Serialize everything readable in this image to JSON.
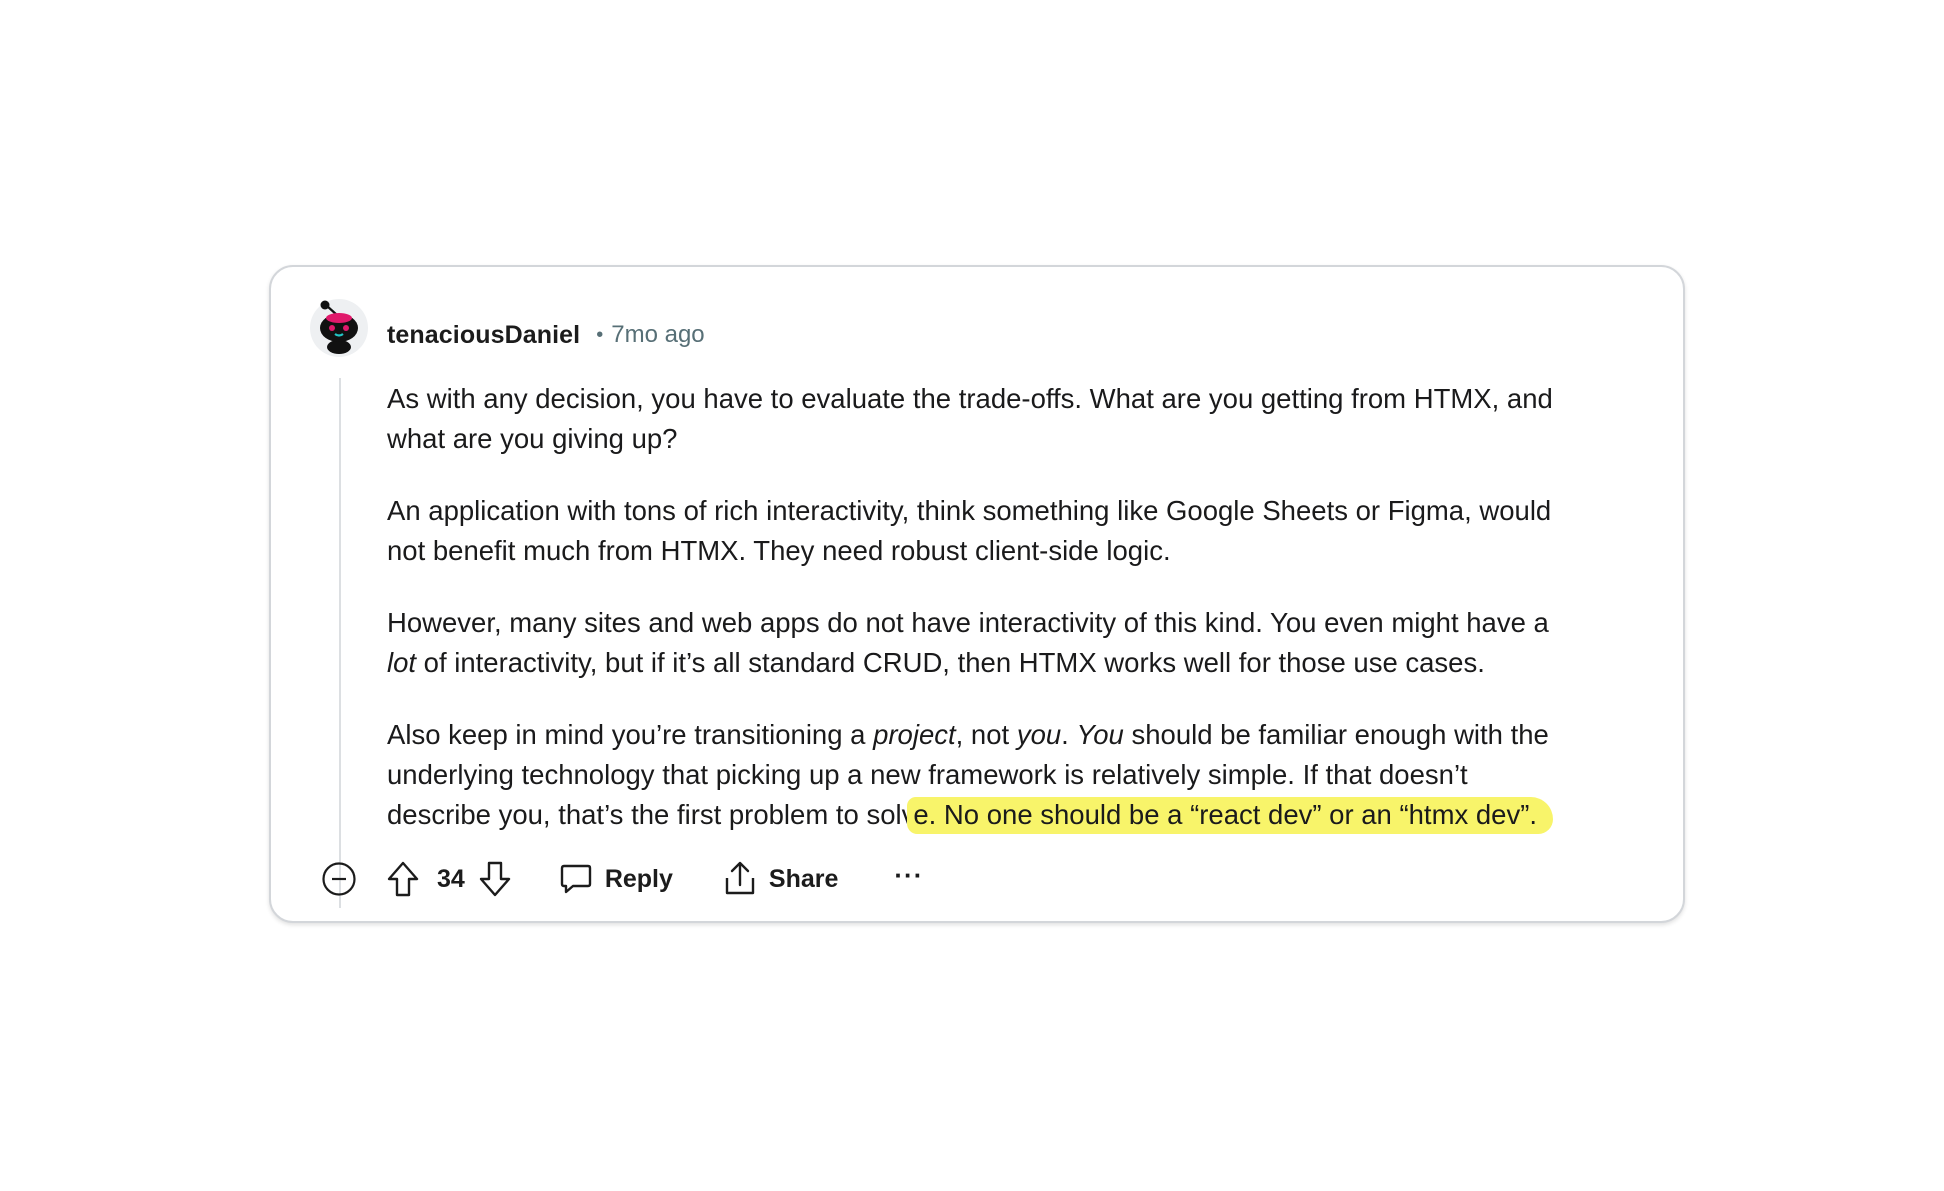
{
  "comment": {
    "author": "tenaciousDaniel",
    "separator": "•",
    "time": "7mo ago",
    "paragraphs": {
      "p1": {
        "line1": "As with any decision, you have to evaluate the trade-offs. What are you getting from HTMX, and",
        "line2": "what are you giving up?"
      },
      "p2": {
        "line1": "An application with tons of rich interactivity, think something like Google Sheets or Figma, would",
        "line2": "not benefit much from HTMX. They need robust client-side logic."
      },
      "p3": {
        "line1": "However, many sites and web apps do not have interactivity of this kind. You even might have a",
        "line2_em": "lot",
        "line2_rest": " of interactivity, but if it’s all standard CRUD, then HTMX works well for those use cases."
      },
      "p4": {
        "l1_a": "Also keep in mind you’re transitioning a ",
        "l1_em1": "project",
        "l1_b": ", not ",
        "l1_em2": "you",
        "l1_c": ". ",
        "l1_em3": "You",
        "l1_d": " should be familiar enough with the",
        "line2": "underlying technology that picking up a new framework is relatively simple. If that doesn’t",
        "line3_plain": "describe you, that’s the first problem to solv",
        "line3_highlight": "e. No one should be a “react dev” or an “htmx dev”."
      }
    }
  },
  "actions": {
    "score": "34",
    "reply_label": "Reply",
    "share_label": "Share",
    "more_label": "···"
  },
  "colors": {
    "highlight": "#f8f46a",
    "meta_text": "#576f76",
    "border": "#d3d6da"
  },
  "icons": {
    "avatar": "snoo-avatar-icon",
    "collapse": "collapse-minus-icon",
    "upvote": "upvote-arrow-icon",
    "downvote": "downvote-arrow-icon",
    "reply": "comment-bubble-icon",
    "share": "share-icon"
  }
}
